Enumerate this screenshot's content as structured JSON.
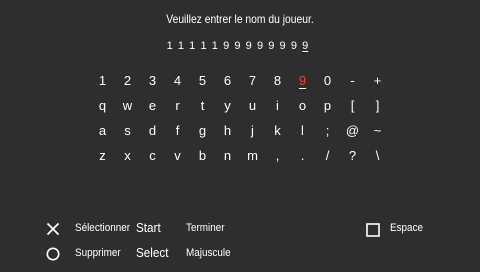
{
  "prompt": "Veuillez entrer le nom du joueur.",
  "entry": {
    "chars": [
      "1",
      "1",
      "1",
      "1",
      "1",
      "9",
      "9",
      "9",
      "9",
      "9",
      "9",
      "9",
      "9"
    ]
  },
  "keyboard": {
    "rows": [
      [
        "1",
        "2",
        "3",
        "4",
        "5",
        "6",
        "7",
        "8",
        "9",
        "0",
        "-",
        "+"
      ],
      [
        "q",
        "w",
        "e",
        "r",
        "t",
        "y",
        "u",
        "i",
        "o",
        "p",
        "[",
        "]"
      ],
      [
        "a",
        "s",
        "d",
        "f",
        "g",
        "h",
        "j",
        "k",
        "l",
        ";",
        "@",
        "~"
      ],
      [
        "z",
        "x",
        "c",
        "v",
        "b",
        "n",
        "m",
        ",",
        ".",
        "/",
        "?",
        "\\"
      ]
    ],
    "selected_key": "9",
    "accent_color": "#e8463a"
  },
  "controls": {
    "cross_icon": "cross-icon",
    "select_label": "Sélectionner",
    "start_word": "Start",
    "finish_label": "Terminer",
    "square_icon": "square-icon",
    "space_label": "Espace",
    "circle_icon": "circle-icon",
    "delete_label": "Supprimer",
    "select_word": "Select",
    "caps_label": "Majuscule"
  }
}
